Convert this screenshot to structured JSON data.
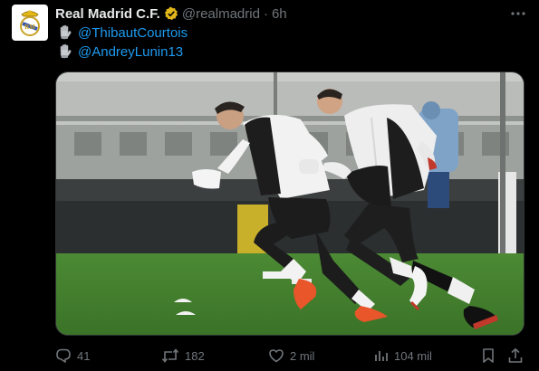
{
  "account": {
    "name": "Real Madrid C.F.",
    "handle": "@realmadrid",
    "separator": "·",
    "time": "6h"
  },
  "tweet": {
    "lines": [
      {
        "icon": "goalkeeper-glove-icon",
        "mention": "@ThibautCourtois"
      },
      {
        "icon": "goalkeeper-glove-icon",
        "mention": "@AndreyLunin13"
      }
    ]
  },
  "media": {
    "kind": "photo",
    "subject": "two goalkeepers sprinting on a training pitch"
  },
  "actions": {
    "replies": "41",
    "retweets": "182",
    "likes": "2 mil",
    "views": "104 mil"
  },
  "colors": {
    "background": "#000000",
    "text": "#e7e9ea",
    "muted": "#71767b",
    "link": "#1d9bf0",
    "verified_badge": "#e2b719"
  }
}
